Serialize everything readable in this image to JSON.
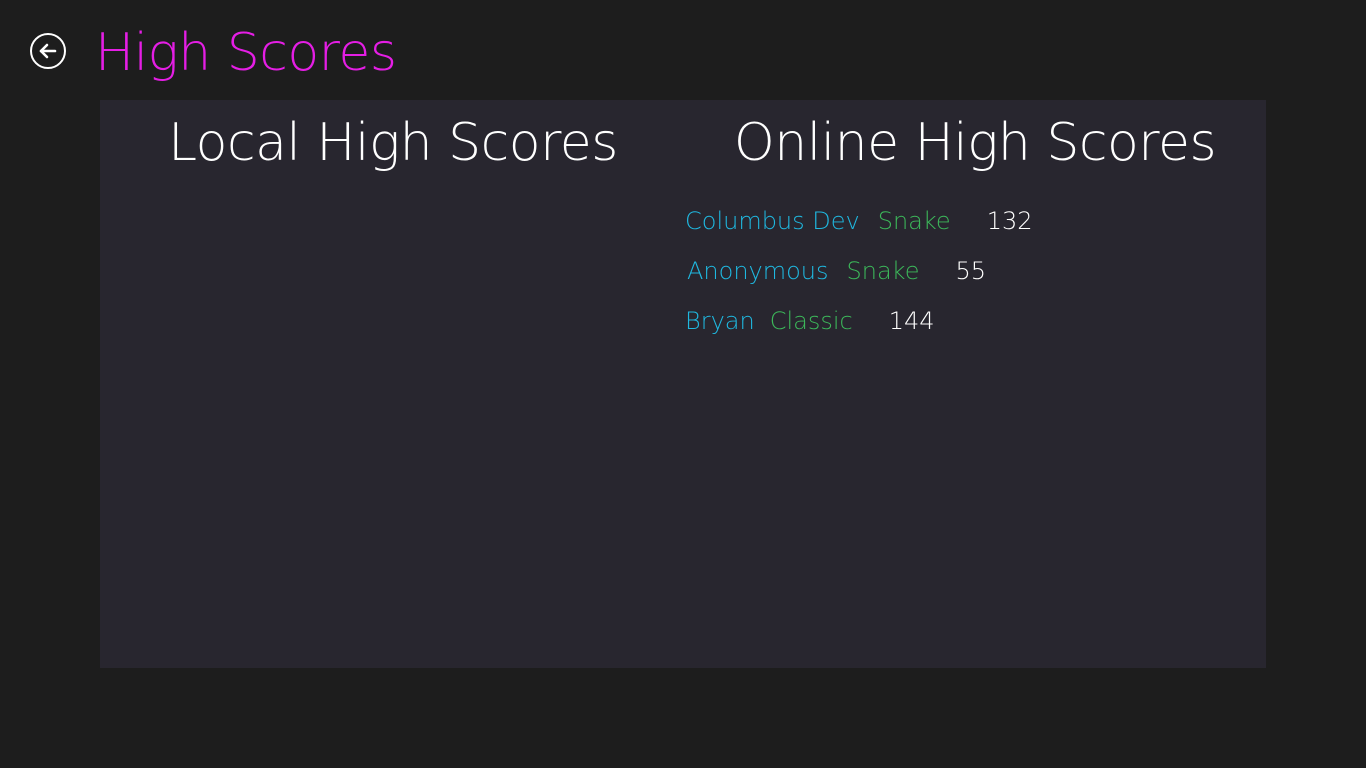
{
  "header": {
    "title": "High Scores",
    "back_icon": "back-arrow-circle-icon"
  },
  "local": {
    "heading": "Local High Scores",
    "entries": []
  },
  "online": {
    "heading": "Online High Scores",
    "entries": [
      {
        "name": "Columbus Dev",
        "mode": "Snake",
        "score": "132"
      },
      {
        "name": "Anonymous",
        "mode": "Snake",
        "score": "55"
      },
      {
        "name": "Bryan",
        "mode": "Classic",
        "score": "144"
      }
    ]
  },
  "colors": {
    "background": "#1d1d1d",
    "panel": "#28262f",
    "title_accent": "#e51ee5",
    "player_name": "#1fb8e0",
    "game_mode": "#3cb85a",
    "score": "#ffffff"
  }
}
